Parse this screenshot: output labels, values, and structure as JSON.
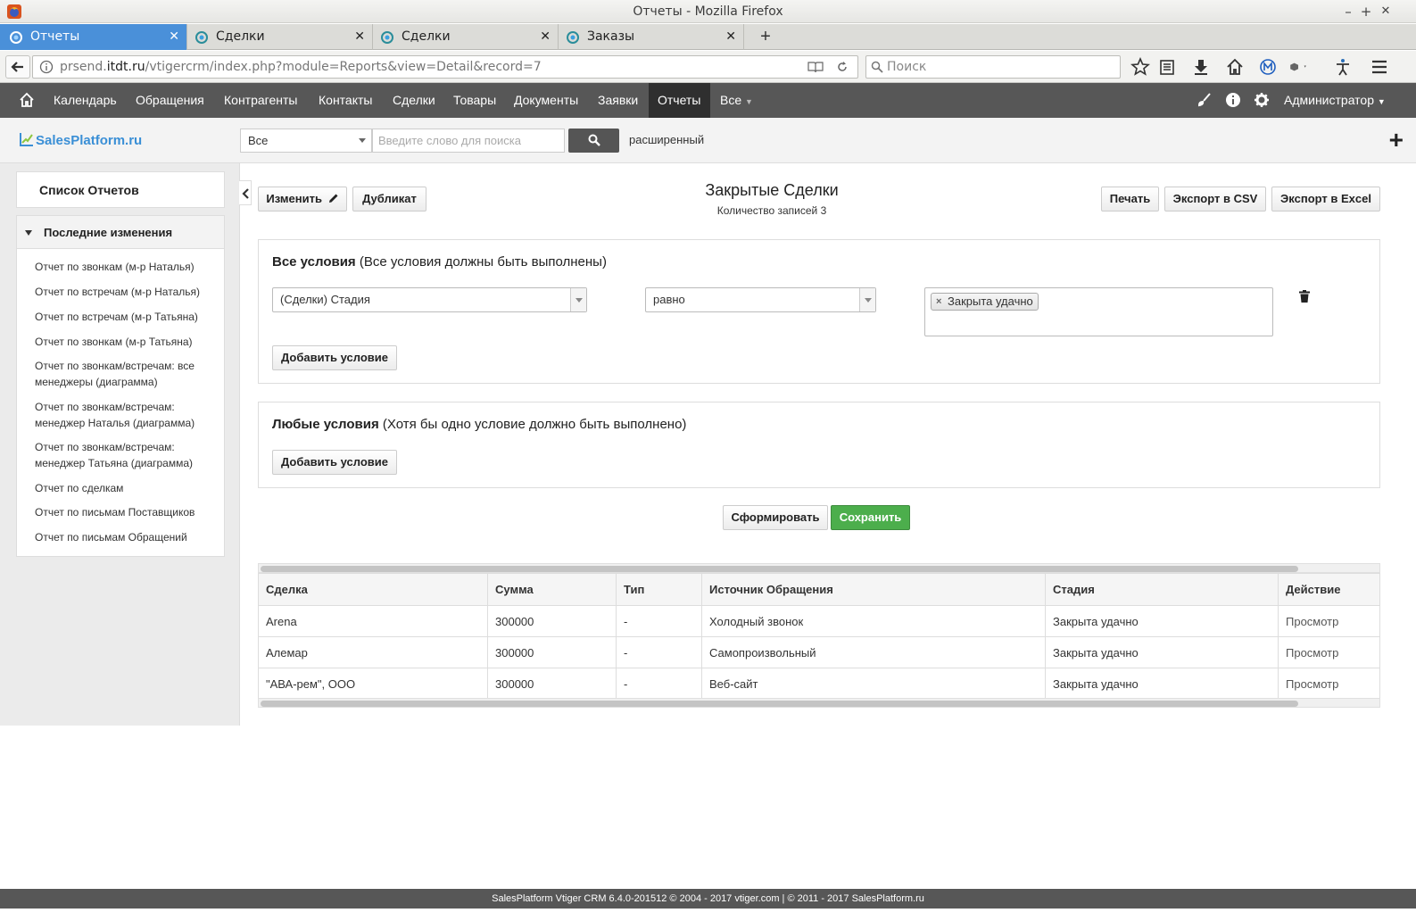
{
  "window": {
    "title": "Отчеты - Mozilla Firefox",
    "min": "–",
    "max": "+",
    "close": "✕"
  },
  "tabs": [
    {
      "label": "Отчеты",
      "active": true
    },
    {
      "label": "Сделки",
      "active": false
    },
    {
      "label": "Сделки",
      "active": false
    },
    {
      "label": "Заказы",
      "active": false
    }
  ],
  "tab_close": "✕",
  "new_tab": "+",
  "urlbar": {
    "host_prefix": "prsend.",
    "host": "itdt.ru",
    "path": "/vtigercrm/index.php?module=Reports&view=Detail&record=7"
  },
  "browser_search": {
    "placeholder": "Поиск"
  },
  "crm_menu": {
    "items": [
      "Календарь",
      "Обращения",
      "Контрагенты",
      "Контакты",
      "Сделки",
      "Товары",
      "Документы",
      "Заявки",
      "Отчеты",
      "Все"
    ],
    "active": "Отчеты",
    "user": "Администратор"
  },
  "header": {
    "logo": "SalesPlatform.ru",
    "search_scope": "Все",
    "search_placeholder": "Введите слово для поиска",
    "advanced": "расширенный",
    "add": "+"
  },
  "sidebar": {
    "title": "Список Отчетов",
    "section": "Последние изменения",
    "links": [
      "Отчет по звонкам (м-р Наталья)",
      "Отчет по встречам (м-р Наталья)",
      "Отчет по встречам (м-р Татьяна)",
      "Отчет по звонкам (м-р Татьяна)",
      "Отчет по звонкам/встречам: все менеджеры (диаграмма)",
      "Отчет по звонкам/встречам: менеджер Наталья (диаграмма)",
      "Отчет по звонкам/встречам: менеджер Татьяна (диаграмма)",
      "Отчет по сделкам",
      "Отчет по письмам Поставщиков",
      "Отчет по письмам Обращений"
    ]
  },
  "report": {
    "title": "Закрытые Сделки",
    "count": "Количество записей 3",
    "edit": "Изменить",
    "duplicate": "Дубликат",
    "print": "Печать",
    "export_csv": "Экспорт в CSV",
    "export_excel": "Экспорт в Excel"
  },
  "conditions_all": {
    "title": "Все условия",
    "hint": "(Все условия должны быть выполнены)",
    "field": "(Сделки) Стадия",
    "operator": "равно",
    "value": "Закрыта удачно",
    "add": "Добавить условие"
  },
  "conditions_any": {
    "title": "Любые условия",
    "hint": "(Хотя бы одно условие должно быть выполнено)",
    "add": "Добавить условие"
  },
  "actions": {
    "generate": "Сформировать",
    "save": "Сохранить"
  },
  "table": {
    "columns": [
      "Сделка",
      "Сумма",
      "Тип",
      "Источник Обращения",
      "Стадия",
      "Действие"
    ],
    "rows": [
      [
        "Arena",
        "300000",
        "-",
        "Холодный звонок",
        "Закрыта удачно",
        "Просмотр"
      ],
      [
        "Алемар",
        "300000",
        "-",
        "Самопроизвольный",
        "Закрыта удачно",
        "Просмотр"
      ],
      [
        "\"АВА-рем\", ООО",
        "300000",
        "-",
        "Веб-сайт",
        "Закрыта удачно",
        "Просмотр"
      ]
    ]
  },
  "footer": "SalesPlatform Vtiger CRM 6.4.0-201512  © 2004 - 2017  vtiger.com | © 2011 - 2017  SalesPlatform.ru",
  "colors": {
    "menu_bg": "#575757",
    "tab_active": "#4a90d9",
    "save_green": "#4cae4c",
    "logo_blue": "#3a8fd6"
  }
}
